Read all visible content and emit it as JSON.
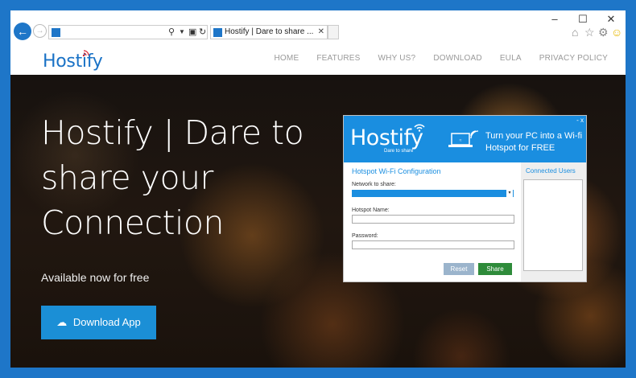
{
  "browser": {
    "tab_title": "Hostify | Dare to share ...",
    "icons": [
      "back-arrow-icon",
      "forward-arrow-icon",
      "search-icon",
      "lock-icon",
      "refresh-icon",
      "home-icon",
      "star-icon",
      "gear-icon",
      "smiley-icon"
    ]
  },
  "site": {
    "logo": "Hostify",
    "nav": [
      "HOME",
      "FEATURES",
      "WHY US?",
      "DOWNLOAD",
      "EULA",
      "PRIVACY POLICY"
    ]
  },
  "hero": {
    "title": "Hostify | Dare to share your Connection",
    "subtitle": "Available now for free",
    "download_label": "Download App"
  },
  "app": {
    "logo": "Hostify",
    "tagline": "Dare to share",
    "promo": "Turn your PC into a Wi-fi Hotspot for FREE",
    "config_title": "Hotspot Wi-Fi Configuration",
    "network_label": "Network to share:",
    "hotspot_name_label": "Hotspot Name:",
    "password_label": "Password:",
    "reset_label": "Reset",
    "share_label": "Share",
    "users_title": "Connected Users",
    "close_glyph": "- x"
  },
  "colors": {
    "accent": "#1a8ee0",
    "window_frame": "#1e76c8",
    "share_button": "#2e8b3a"
  }
}
